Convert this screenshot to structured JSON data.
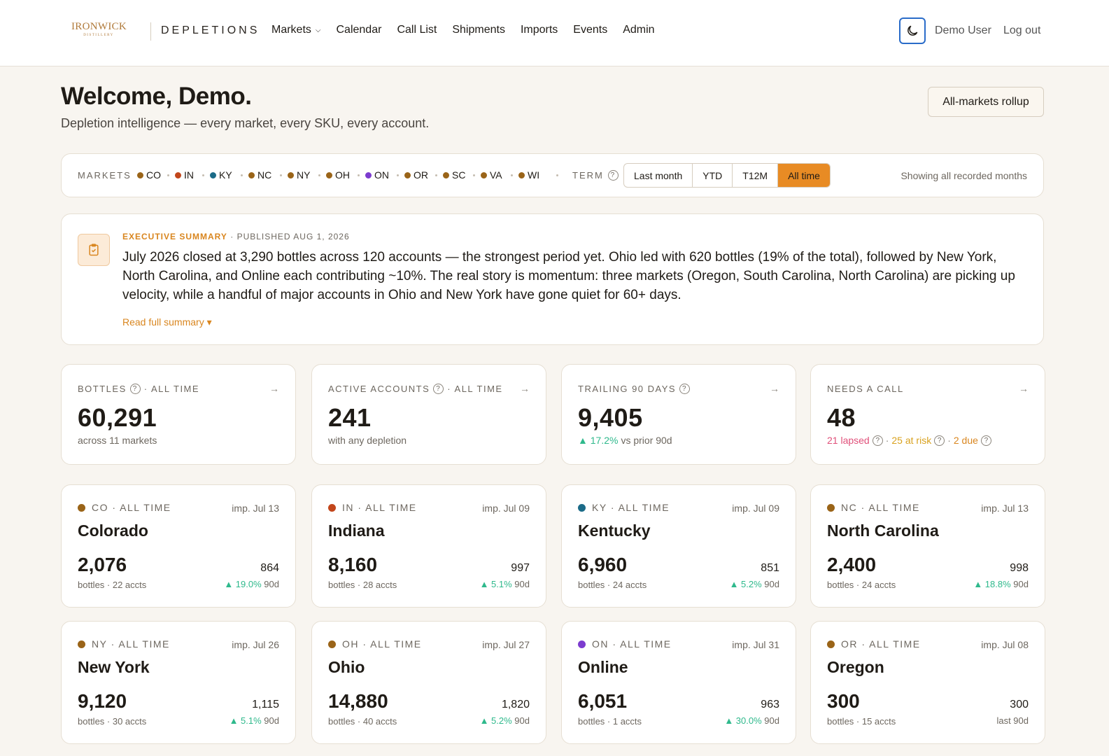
{
  "header": {
    "logo_text": "IRONWICK",
    "logo_sub": "DISTILLERY",
    "brand": "DEPLETIONS",
    "nav": [
      "Markets",
      "Calendar",
      "Call List",
      "Shipments",
      "Imports",
      "Events",
      "Admin"
    ],
    "user": "Demo User",
    "logout": "Log out"
  },
  "hero": {
    "title": "Welcome, Demo.",
    "subtitle": "Depletion intelligence — every market, every SKU, every account.",
    "rollup_button": "All-markets rollup"
  },
  "filters": {
    "markets_label": "MARKETS",
    "markets": [
      {
        "code": "CO",
        "color": "#9a6418"
      },
      {
        "code": "IN",
        "color": "#c2461b"
      },
      {
        "code": "KY",
        "color": "#1b6b88"
      },
      {
        "code": "NC",
        "color": "#9a6418"
      },
      {
        "code": "NY",
        "color": "#9a6418"
      },
      {
        "code": "OH",
        "color": "#9a6418"
      },
      {
        "code": "ON",
        "color": "#7c3ccf"
      },
      {
        "code": "OR",
        "color": "#9a6418"
      },
      {
        "code": "SC",
        "color": "#9a6418"
      },
      {
        "code": "VA",
        "color": "#9a6418"
      },
      {
        "code": "WI",
        "color": "#9a6418"
      }
    ],
    "term_label": "TERM",
    "terms": [
      "Last month",
      "YTD",
      "T12M",
      "All time"
    ],
    "active_term": "All time",
    "showing": "Showing all recorded months"
  },
  "summary": {
    "label": "EXECUTIVE SUMMARY",
    "published": "· PUBLISHED AUG 1, 2026",
    "text": "July 2026 closed at 3,290 bottles across 120 accounts — the strongest period yet. Ohio led with 620 bottles (19% of the total), followed by New York, North Carolina, and Online each contributing ~10%. The real story is momentum: three markets (Oregon, South Carolina, North Carolina) are picking up velocity, while a handful of major accounts in Ohio and New York have gone quiet for 60+ days.",
    "read_more": "Read full summary ▾"
  },
  "stats": [
    {
      "label": "BOTTLES",
      "suffix": "· ALL TIME",
      "value": "60,291",
      "sub": "across 11 markets"
    },
    {
      "label": "ACTIVE ACCOUNTS",
      "suffix": "· ALL TIME",
      "value": "241",
      "sub": "with any depletion"
    },
    {
      "label": "TRAILING 90 DAYS",
      "suffix": "",
      "value": "9,405",
      "change": "▲ 17.2%",
      "sub": "vs prior 90d"
    },
    {
      "label": "NEEDS A CALL",
      "suffix": "",
      "value": "48",
      "lapsed": "21 lapsed",
      "at_risk": "25 at risk",
      "due": "2 due"
    }
  ],
  "markets": [
    {
      "code": "CO",
      "color": "#9a6418",
      "term": "CO · ALL TIME",
      "date": "imp. Jul 13",
      "name": "Colorado",
      "bottles": "2,076",
      "sub": "bottles · 22 accts",
      "d90": "864",
      "change": "▲ 19.0%",
      "unit": "90d"
    },
    {
      "code": "IN",
      "color": "#c2461b",
      "term": "IN · ALL TIME",
      "date": "imp. Jul 09",
      "name": "Indiana",
      "bottles": "8,160",
      "sub": "bottles · 28 accts",
      "d90": "997",
      "change": "▲ 5.1%",
      "unit": "90d"
    },
    {
      "code": "KY",
      "color": "#1b6b88",
      "term": "KY · ALL TIME",
      "date": "imp. Jul 09",
      "name": "Kentucky",
      "bottles": "6,960",
      "sub": "bottles · 24 accts",
      "d90": "851",
      "change": "▲ 5.2%",
      "unit": "90d"
    },
    {
      "code": "NC",
      "color": "#9a6418",
      "term": "NC · ALL TIME",
      "date": "imp. Jul 13",
      "name": "North Carolina",
      "bottles": "2,400",
      "sub": "bottles · 24 accts",
      "d90": "998",
      "change": "▲ 18.8%",
      "unit": "90d"
    },
    {
      "code": "NY",
      "color": "#9a6418",
      "term": "NY · ALL TIME",
      "date": "imp. Jul 26",
      "name": "New York",
      "bottles": "9,120",
      "sub": "bottles · 30 accts",
      "d90": "1,115",
      "change": "▲ 5.1%",
      "unit": "90d"
    },
    {
      "code": "OH",
      "color": "#9a6418",
      "term": "OH · ALL TIME",
      "date": "imp. Jul 27",
      "name": "Ohio",
      "bottles": "14,880",
      "sub": "bottles · 40 accts",
      "d90": "1,820",
      "change": "▲ 5.2%",
      "unit": "90d"
    },
    {
      "code": "ON",
      "color": "#7c3ccf",
      "term": "ON · ALL TIME",
      "date": "imp. Jul 31",
      "name": "Online",
      "bottles": "6,051",
      "sub": "bottles · 1 accts",
      "d90": "963",
      "change": "▲ 30.0%",
      "unit": "90d"
    },
    {
      "code": "OR",
      "color": "#9a6418",
      "term": "OR · ALL TIME",
      "date": "imp. Jul 08",
      "name": "Oregon",
      "bottles": "300",
      "sub": "bottles · 15 accts",
      "d90": "300",
      "change": "",
      "unit": "last 90d"
    }
  ],
  "icons": {
    "theme": "moon-icon",
    "arrow": "arrow-right-icon",
    "summary": "clipboard-check-icon"
  }
}
